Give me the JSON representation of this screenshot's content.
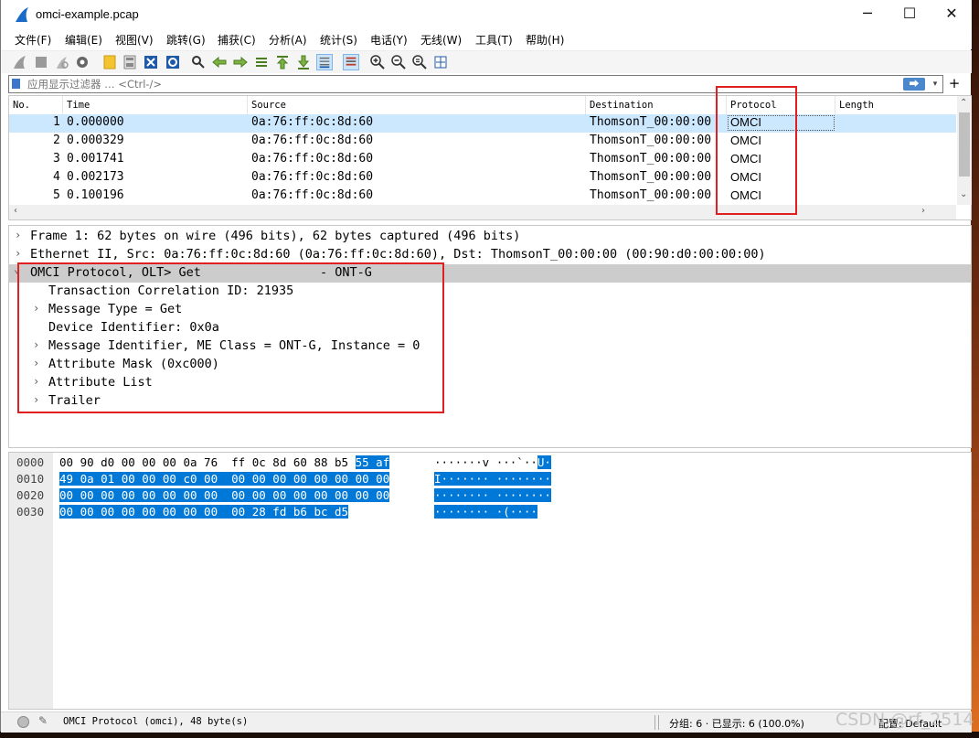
{
  "window": {
    "title": "omci-example.pcap",
    "minimize_glyph": "─",
    "maximize_glyph": "☐",
    "close_glyph": "✕"
  },
  "menu": [
    "文件(F)",
    "编辑(E)",
    "视图(V)",
    "跳转(G)",
    "捕获(C)",
    "分析(A)",
    "统计(S)",
    "电话(Y)",
    "无线(W)",
    "工具(T)",
    "帮助(H)"
  ],
  "toolbar": {
    "icons": [
      "shark-fin-start-icon",
      "stop-icon",
      "restart-icon",
      "capture-options-icon",
      "open-file-icon",
      "save-file-icon",
      "close-file-icon",
      "reload-icon",
      "find-packet-icon",
      "go-back-icon",
      "go-forward-icon",
      "go-to-packet-icon",
      "go-first-icon",
      "go-last-icon",
      "autoscroll-icon",
      "colorize-icon",
      "zoom-in-icon",
      "zoom-out-icon",
      "zoom-normal-icon",
      "resize-columns-icon"
    ]
  },
  "filter": {
    "placeholder": "应用显示过滤器 … <Ctrl-/>",
    "apply_glyph": "⮕",
    "dropdown_glyph": "▾",
    "add_glyph": "+"
  },
  "packet_list": {
    "columns": [
      "No.",
      "Time",
      "Source",
      "Destination",
      "Protocol",
      "Length"
    ],
    "rows": [
      {
        "no": "1",
        "time": "0.000000",
        "source": "0a:76:ff:0c:8d:60",
        "destination": "ThomsonT_00:00:00",
        "protocol": "OMCI",
        "length": ""
      },
      {
        "no": "2",
        "time": "0.000329",
        "source": "0a:76:ff:0c:8d:60",
        "destination": "ThomsonT_00:00:00",
        "protocol": "OMCI",
        "length": ""
      },
      {
        "no": "3",
        "time": "0.001741",
        "source": "0a:76:ff:0c:8d:60",
        "destination": "ThomsonT_00:00:00",
        "protocol": "OMCI",
        "length": ""
      },
      {
        "no": "4",
        "time": "0.002173",
        "source": "0a:76:ff:0c:8d:60",
        "destination": "ThomsonT_00:00:00",
        "protocol": "OMCI",
        "length": ""
      },
      {
        "no": "5",
        "time": "0.100196",
        "source": "0a:76:ff:0c:8d:60",
        "destination": "ThomsonT_00:00:00",
        "protocol": "OMCI",
        "length": ""
      }
    ]
  },
  "details": [
    {
      "text": "Frame 1: 62 bytes on wire (496 bits), 62 bytes captured (496 bits)",
      "indent": 0,
      "expander": "›"
    },
    {
      "text": "Ethernet II, Src: 0a:76:ff:0c:8d:60 (0a:76:ff:0c:8d:60), Dst: ThomsonT_00:00:00 (00:90:d0:00:00:00)",
      "indent": 0,
      "expander": "›"
    },
    {
      "text": "OMCI Protocol, OLT> Get                - ONT-G",
      "indent": 0,
      "expander": "⌄"
    },
    {
      "text": "Transaction Correlation ID: 21935",
      "indent": 1,
      "expander": ""
    },
    {
      "text": "Message Type = Get",
      "indent": 1,
      "expander": "›"
    },
    {
      "text": "Device Identifier: 0x0a",
      "indent": 1,
      "expander": ""
    },
    {
      "text": "Message Identifier, ME Class = ONT-G, Instance = 0",
      "indent": 1,
      "expander": "›"
    },
    {
      "text": "Attribute Mask (0xc000)",
      "indent": 1,
      "expander": "›"
    },
    {
      "text": "Attribute List",
      "indent": 1,
      "expander": "›"
    },
    {
      "text": "Trailer",
      "indent": 1,
      "expander": "›"
    }
  ],
  "hex": [
    {
      "offset": "0000",
      "plain": "00 90 d0 00 00 00 0a 76  ff 0c 8d 60 88 b5 ",
      "hl": "55 af",
      "ascii_plain": "·······v ···`··",
      "ascii_hl": "U·"
    },
    {
      "offset": "0010",
      "plain": "",
      "hl": "49 0a 01 00 00 00 c0 00  00 00 00 00 00 00 00 00",
      "ascii_plain": "",
      "ascii_hl": "I······· ········"
    },
    {
      "offset": "0020",
      "plain": "",
      "hl": "00 00 00 00 00 00 00 00  00 00 00 00 00 00 00 00",
      "ascii_plain": "",
      "ascii_hl": "········ ········"
    },
    {
      "offset": "0030",
      "plain": "",
      "hl": "00 00 00 00 00 00 00 00  00 28 fd b6 bc d5",
      "ascii_plain": "",
      "ascii_hl": "········ ·(····"
    }
  ],
  "status": {
    "field": "OMCI Protocol (omci), 48 byte(s)",
    "packets": "分组: 6 · 已显示: 6 (100.0%)",
    "profile": "配置: Default"
  },
  "watermark": "CSDN @rf_2514"
}
